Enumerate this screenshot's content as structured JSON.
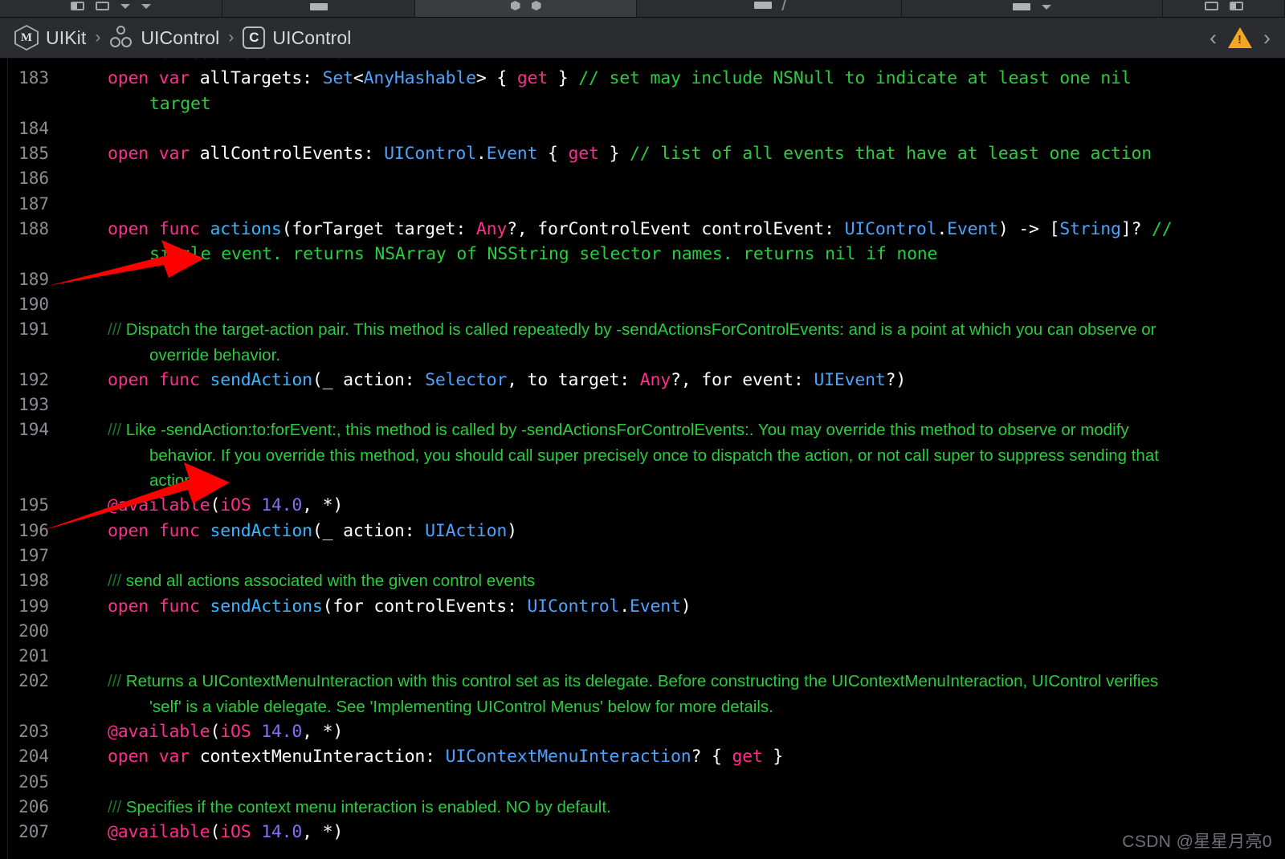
{
  "window": {
    "toolbar_icons": [
      "sidebar-toggle-icon",
      "grid-icon",
      "chevron-down-icon",
      "chevron-icon",
      "rect-icon",
      "hexagons-icon",
      "rect-icon",
      "slash-icon",
      "rect-icon",
      "chevron-down-icon",
      "panel-icon",
      "inspector-icon"
    ]
  },
  "breadcrumb": {
    "items": [
      {
        "icon": "module-icon",
        "icon_letter": "M",
        "label": "UIKit"
      },
      {
        "icon": "protocol-icon",
        "icon_letter": "",
        "label": "UIControl"
      },
      {
        "icon": "class-icon",
        "icon_letter": "C",
        "label": "UIControl"
      }
    ],
    "separator": "›",
    "prev_label": "‹",
    "next_label": "›",
    "warning_icon": "warning-triangle-icon"
  },
  "editor": {
    "lines": [
      {
        "num": "",
        "indent": "cont",
        "doc": false,
        "tokens": [
          {
            "t": "for each event kind",
            "c": "cmt"
          }
        ]
      },
      {
        "num": "183",
        "doc": false,
        "tokens": [
          {
            "t": "open ",
            "c": "kw"
          },
          {
            "t": "var ",
            "c": "kw"
          },
          {
            "t": "allTargets",
            "c": "pln"
          },
          {
            "t": ": ",
            "c": "pln"
          },
          {
            "t": "Set",
            "c": "typ"
          },
          {
            "t": "<",
            "c": "pln"
          },
          {
            "t": "AnyHashable",
            "c": "typ"
          },
          {
            "t": "> { ",
            "c": "pln"
          },
          {
            "t": "get",
            "c": "kw"
          },
          {
            "t": " } ",
            "c": "pln"
          },
          {
            "t": "// set may include NSNull to indicate at least one nil",
            "c": "cmt"
          }
        ]
      },
      {
        "num": "",
        "indent": "cont",
        "doc": false,
        "tokens": [
          {
            "t": "target",
            "c": "cmt"
          }
        ]
      },
      {
        "num": "184",
        "doc": false,
        "tokens": []
      },
      {
        "num": "185",
        "doc": false,
        "tokens": [
          {
            "t": "open ",
            "c": "kw"
          },
          {
            "t": "var ",
            "c": "kw"
          },
          {
            "t": "allControlEvents",
            "c": "pln"
          },
          {
            "t": ": ",
            "c": "pln"
          },
          {
            "t": "UIControl",
            "c": "typ"
          },
          {
            "t": ".",
            "c": "pln"
          },
          {
            "t": "Event",
            "c": "typ"
          },
          {
            "t": " { ",
            "c": "pln"
          },
          {
            "t": "get",
            "c": "kw"
          },
          {
            "t": " } ",
            "c": "pln"
          },
          {
            "t": "// list of all events that have at least one action",
            "c": "cmt"
          }
        ]
      },
      {
        "num": "186",
        "doc": false,
        "tokens": []
      },
      {
        "num": "187",
        "doc": false,
        "tokens": []
      },
      {
        "num": "188",
        "doc": false,
        "tokens": [
          {
            "t": "open ",
            "c": "kw"
          },
          {
            "t": "func ",
            "c": "kw"
          },
          {
            "t": "actions",
            "c": "fn"
          },
          {
            "t": "(forTarget target: ",
            "c": "pln"
          },
          {
            "t": "Any",
            "c": "kw"
          },
          {
            "t": "?, forControlEvent controlEvent: ",
            "c": "pln"
          },
          {
            "t": "UIControl",
            "c": "typ"
          },
          {
            "t": ".",
            "c": "pln"
          },
          {
            "t": "Event",
            "c": "typ"
          },
          {
            "t": ") -> [",
            "c": "pln"
          },
          {
            "t": "String",
            "c": "typ"
          },
          {
            "t": "]? ",
            "c": "pln"
          },
          {
            "t": "//",
            "c": "cmt"
          }
        ]
      },
      {
        "num": "",
        "indent": "cont",
        "doc": false,
        "tokens": [
          {
            "t": "single event. returns NSArray of NSString selector names. returns nil if none",
            "c": "cmt"
          }
        ]
      },
      {
        "num": "189",
        "doc": false,
        "tokens": []
      },
      {
        "num": "190",
        "doc": false,
        "tokens": []
      },
      {
        "num": "191",
        "doc": true,
        "tokens": [
          {
            "t": "/// ",
            "c": "cmt-slash"
          },
          {
            "t": "Dispatch the target-action pair. This method is called repeatedly by -sendActionsForControlEvents: and is a point at which you can observe or",
            "c": "cmt"
          }
        ]
      },
      {
        "num": "",
        "indent": "cont-doc",
        "doc": true,
        "tokens": [
          {
            "t": "override behavior.",
            "c": "cmt"
          }
        ]
      },
      {
        "num": "192",
        "doc": false,
        "tokens": [
          {
            "t": "open ",
            "c": "kw"
          },
          {
            "t": "func ",
            "c": "kw"
          },
          {
            "t": "sendAction",
            "c": "fn"
          },
          {
            "t": "(_ action: ",
            "c": "pln"
          },
          {
            "t": "Selector",
            "c": "typ"
          },
          {
            "t": ", to target: ",
            "c": "pln"
          },
          {
            "t": "Any",
            "c": "kw"
          },
          {
            "t": "?, for event: ",
            "c": "pln"
          },
          {
            "t": "UIEvent",
            "c": "typ"
          },
          {
            "t": "?)",
            "c": "pln"
          }
        ]
      },
      {
        "num": "193",
        "doc": false,
        "tokens": []
      },
      {
        "num": "194",
        "doc": true,
        "tokens": [
          {
            "t": "/// ",
            "c": "cmt-slash"
          },
          {
            "t": "Like -sendAction:to:forEvent:, this method is called by -sendActionsForControlEvents:. You may override this method to observe or modify",
            "c": "cmt"
          }
        ]
      },
      {
        "num": "",
        "indent": "cont-doc",
        "doc": true,
        "tokens": [
          {
            "t": "behavior. If you override this method, you should call super precisely once to dispatch the action, or not call super to suppress sending that",
            "c": "cmt"
          }
        ]
      },
      {
        "num": "",
        "indent": "cont-doc",
        "doc": true,
        "tokens": [
          {
            "t": "action.",
            "c": "cmt"
          }
        ]
      },
      {
        "num": "195",
        "doc": false,
        "tokens": [
          {
            "t": "@available",
            "c": "attr"
          },
          {
            "t": "(",
            "c": "pln"
          },
          {
            "t": "iOS ",
            "c": "attr"
          },
          {
            "t": "14.0",
            "c": "num"
          },
          {
            "t": ", *)",
            "c": "pln"
          }
        ]
      },
      {
        "num": "196",
        "doc": false,
        "tokens": [
          {
            "t": "open ",
            "c": "kw"
          },
          {
            "t": "func ",
            "c": "kw"
          },
          {
            "t": "sendAction",
            "c": "fn"
          },
          {
            "t": "(_ action: ",
            "c": "pln"
          },
          {
            "t": "UIAction",
            "c": "typ"
          },
          {
            "t": ")",
            "c": "pln"
          }
        ]
      },
      {
        "num": "197",
        "doc": false,
        "tokens": []
      },
      {
        "num": "198",
        "doc": true,
        "tokens": [
          {
            "t": "/// ",
            "c": "cmt-slash"
          },
          {
            "t": "send all actions associated with the given control events",
            "c": "cmt"
          }
        ]
      },
      {
        "num": "199",
        "doc": false,
        "tokens": [
          {
            "t": "open ",
            "c": "kw"
          },
          {
            "t": "func ",
            "c": "kw"
          },
          {
            "t": "sendActions",
            "c": "fn"
          },
          {
            "t": "(for controlEvents: ",
            "c": "pln"
          },
          {
            "t": "UIControl",
            "c": "typ"
          },
          {
            "t": ".",
            "c": "pln"
          },
          {
            "t": "Event",
            "c": "typ"
          },
          {
            "t": ")",
            "c": "pln"
          }
        ]
      },
      {
        "num": "200",
        "doc": false,
        "tokens": []
      },
      {
        "num": "201",
        "doc": false,
        "tokens": []
      },
      {
        "num": "202",
        "doc": true,
        "tokens": [
          {
            "t": "/// ",
            "c": "cmt-slash"
          },
          {
            "t": "Returns a UIContextMenuInteraction with this control set as its delegate. Before constructing the UIContextMenuInteraction, UIControl verifies",
            "c": "cmt"
          }
        ]
      },
      {
        "num": "",
        "indent": "cont-doc",
        "doc": true,
        "tokens": [
          {
            "t": "'self' is a viable delegate. See 'Implementing UIControl Menus' below for more details.",
            "c": "cmt"
          }
        ]
      },
      {
        "num": "203",
        "doc": false,
        "tokens": [
          {
            "t": "@available",
            "c": "attr"
          },
          {
            "t": "(",
            "c": "pln"
          },
          {
            "t": "iOS ",
            "c": "attr"
          },
          {
            "t": "14.0",
            "c": "num"
          },
          {
            "t": ", *)",
            "c": "pln"
          }
        ]
      },
      {
        "num": "204",
        "doc": false,
        "tokens": [
          {
            "t": "open ",
            "c": "kw"
          },
          {
            "t": "var ",
            "c": "kw"
          },
          {
            "t": "contextMenuInteraction",
            "c": "pln"
          },
          {
            "t": ": ",
            "c": "pln"
          },
          {
            "t": "UIContextMenuInteraction",
            "c": "typ"
          },
          {
            "t": "? { ",
            "c": "pln"
          },
          {
            "t": "get",
            "c": "kw"
          },
          {
            "t": " }",
            "c": "pln"
          }
        ]
      },
      {
        "num": "205",
        "doc": false,
        "tokens": []
      },
      {
        "num": "206",
        "doc": true,
        "tokens": [
          {
            "t": "/// ",
            "c": "cmt-slash"
          },
          {
            "t": "Specifies if the context menu interaction is enabled. NO by default.",
            "c": "cmt"
          }
        ]
      },
      {
        "num": "207",
        "doc": false,
        "tokens": [
          {
            "t": "@available",
            "c": "attr"
          },
          {
            "t": "(",
            "c": "pln"
          },
          {
            "t": "iOS ",
            "c": "attr"
          },
          {
            "t": "14.0",
            "c": "num"
          },
          {
            "t": ", *)",
            "c": "pln"
          }
        ]
      }
    ]
  },
  "annotations": {
    "arrows": [
      {
        "name": "red-arrow-upper",
        "color": "#ff0000"
      },
      {
        "name": "red-arrow-lower",
        "color": "#ff0000"
      }
    ]
  },
  "watermark": {
    "text": "CSDN @星星月亮0"
  },
  "colors": {
    "background": "#000000",
    "chrome": "#2a2c2f",
    "keyword": "#ff2d8e",
    "type": "#4aa3ff",
    "function": "#37b5ff",
    "comment": "#2bcc3e",
    "number": "#8a6cf6",
    "line_number": "#8b8d90",
    "warning": "#f5a623",
    "arrow": "#ff0000"
  }
}
